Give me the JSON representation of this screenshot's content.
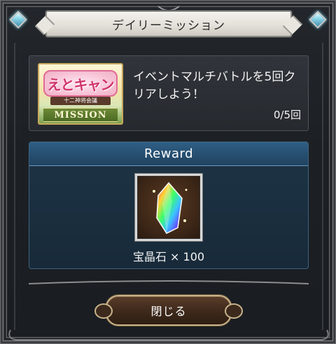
{
  "dialog": {
    "title": "デイリーミッション"
  },
  "mission": {
    "banner": {
      "logo_text": "えとキャン",
      "subtitle": "十二神将会議",
      "ribbon_text": "MISSION"
    },
    "description": "イベントマルチバトルを5回クリアしよう！",
    "progress": "0/5回"
  },
  "reward": {
    "header": "Reward",
    "item_icon": "rainbow-crystal-icon",
    "item_label": "宝晶石 × 100"
  },
  "footer": {
    "close_label": "閉じる"
  },
  "colors": {
    "title_bar": "#e4e1da",
    "reward_header": "#264d6e",
    "button_border": "#c9b48c"
  }
}
